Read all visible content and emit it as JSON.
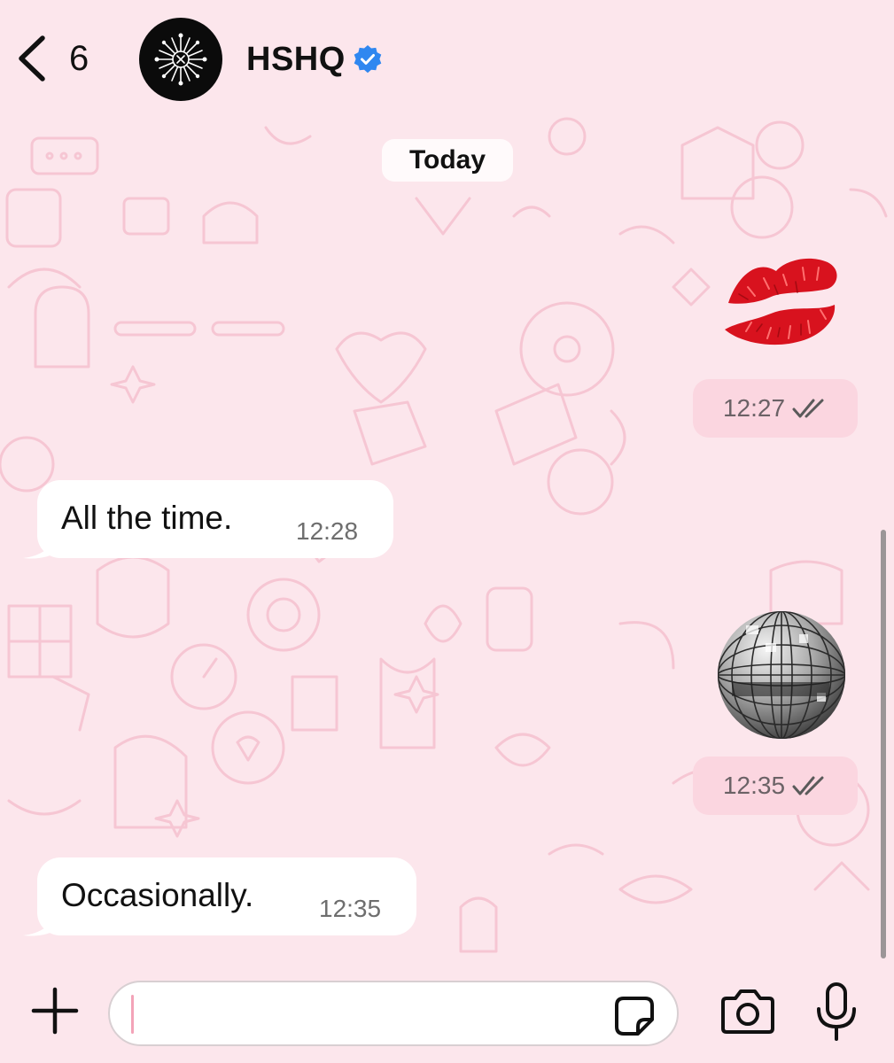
{
  "header": {
    "back_count": "6",
    "contact_name": "HSHQ",
    "verified": true,
    "icons": [
      "chevron-left-icon",
      "verified-badge-icon"
    ]
  },
  "chat": {
    "date_separator": "Today",
    "messages": [
      {
        "direction": "outgoing",
        "type": "sticker",
        "sticker": "kiss-mark",
        "time": "12:27",
        "status": "read"
      },
      {
        "direction": "incoming",
        "type": "text",
        "text": "All the time.",
        "time": "12:28"
      },
      {
        "direction": "outgoing",
        "type": "sticker",
        "sticker": "mirror-ball",
        "time": "12:35",
        "status": "read"
      },
      {
        "direction": "incoming",
        "type": "text",
        "text": "Occasionally.",
        "time": "12:35"
      }
    ]
  },
  "input_bar": {
    "placeholder": "",
    "value": "",
    "icons": [
      "plus-icon",
      "sticker-icon",
      "camera-icon",
      "microphone-icon"
    ]
  },
  "colors": {
    "background": "#fce6ec",
    "outgoing_chip": "#fbd6e0",
    "incoming_bubble": "#ffffff",
    "verified": "#2f87f0",
    "read_ticks": "#5a5a5a"
  }
}
